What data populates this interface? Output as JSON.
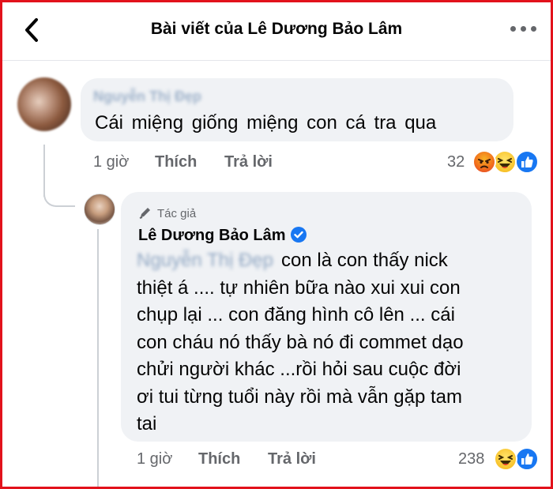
{
  "header": {
    "title": "Bài viết của Lê Dương Bảo Lâm",
    "back_icon": "chevron-left-icon",
    "more_icon": "more-dots-icon"
  },
  "comment": {
    "author_blurred": "Nguyễn Thị Đẹp",
    "text": "Cái  miệng  giống  miệng  con  cá  tra  qua",
    "time": "1 giờ",
    "like_label": "Thích",
    "reply_label": "Trả lời",
    "reaction_count": "32",
    "reactions": [
      "angry-reaction-icon",
      "haha-reaction-icon",
      "like-reaction-icon"
    ]
  },
  "reply": {
    "badge": "Tác giả",
    "author": "Lê Dương Bảo Lâm",
    "mention_blurred": "Nguyễn Thị Đẹp",
    "text_lines": [
      "con là con thấy nick",
      "thiệt á .... tự nhiên bữa nào xui xui con",
      "chụp lại ... con đăng hình cô lên ... cái",
      "con cháu nó thấy bà nó đi commet dạo",
      "chửi người khác ...rồi hỏi sau cuộc đời",
      "ơi tui từng tuổi này rồi mà vẫn gặp tam",
      "tai"
    ],
    "time": "1 giờ",
    "like_label": "Thích",
    "reply_label": "Trả lời",
    "reaction_count": "238",
    "reactions": [
      "haha-reaction-icon",
      "like-reaction-icon"
    ]
  },
  "colors": {
    "frame_border": "#e2121c",
    "bubble_bg": "#f0f2f5",
    "secondary_text": "#65676b",
    "facebook_blue": "#1877f2"
  }
}
